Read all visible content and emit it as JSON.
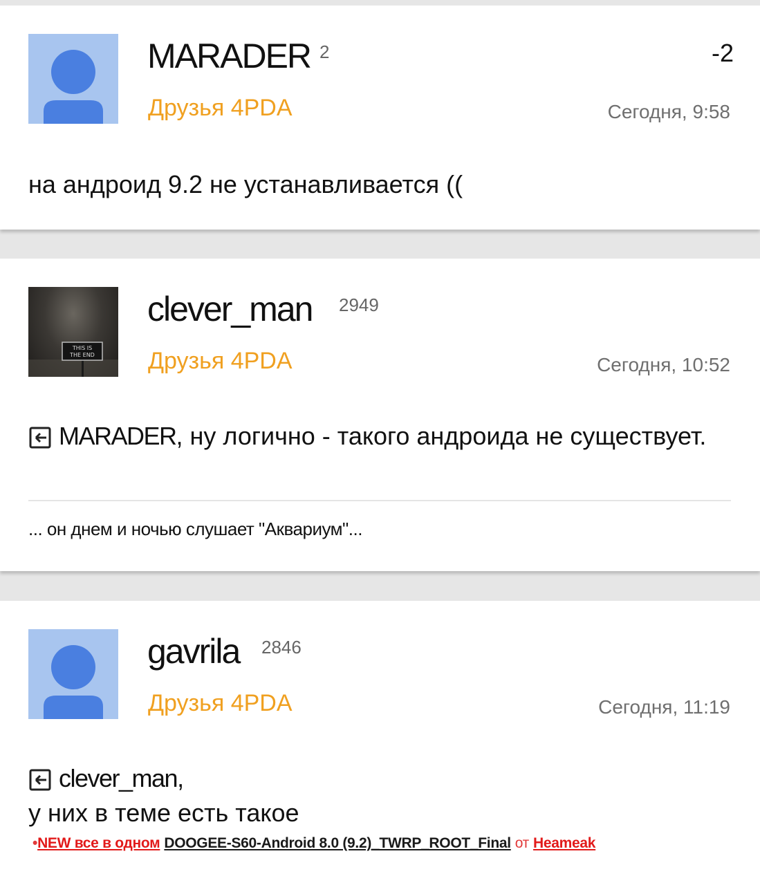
{
  "posts": [
    {
      "nick": "MARADER",
      "rep": "2",
      "group": "Друзья 4PDA",
      "date": "Сегодня, 9:58",
      "karma": "-2",
      "text": "на андроид 9.2 не устанавливается (("
    },
    {
      "nick": "clever_man",
      "rep": "2949",
      "group": "Друзья 4PDA",
      "date": "Сегодня, 10:52",
      "avatar_sign": [
        "THIS IS",
        "THE END"
      ],
      "reply_to": "MARADER",
      "text": ", ну логично - такого андроида не существует.",
      "signature": "... он днем и ночью слушает \"Аквариум\"..."
    },
    {
      "nick": "gavrila",
      "rep": "2846",
      "group": "Друзья 4PDA",
      "date": "Сегодня, 11:19",
      "reply_to": "clever_man,",
      "text": "у них в теме есть такое",
      "attachment": {
        "bullet": "•",
        "prefix": "NEW все в одном",
        "title": "DOOGEE-S60-Android 8.0 (9.2)_TWRP_ROOT_Final",
        "by": "от",
        "author": "Heameak"
      }
    }
  ],
  "colors": {
    "background": "#e6e6e6",
    "card": "#ffffff",
    "group": "#f0a020",
    "avatar_bg": "#a8c5ef",
    "avatar_person": "#4a7fe0",
    "link_red": "#e21a1a"
  }
}
